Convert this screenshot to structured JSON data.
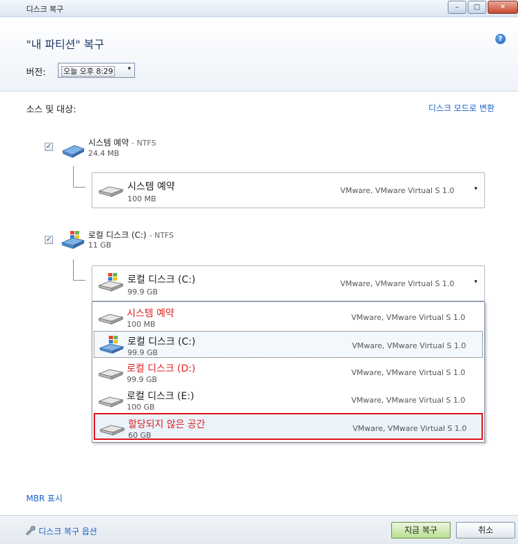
{
  "window": {
    "title": "디스크 복구",
    "minimize": "–",
    "maximize": "□",
    "close": "✕"
  },
  "header": {
    "title": "\"내 파티션\" 복구",
    "help_glyph": "?",
    "version_label": "버전:",
    "version_value": "오늘 오후 8:29",
    "version_arrow": "▾"
  },
  "main": {
    "section_label": "소스 및 대상:",
    "mode_link": "디스크 모드로 변환",
    "sources": [
      {
        "checked": "✓",
        "name": "시스템 예약",
        "fs": "- NTFS",
        "size": "24.4 MB",
        "target": {
          "name": "시스템 예약",
          "size": "100 MB",
          "device": "VMware, VMware Virtual S 1.0",
          "arrow": "▾"
        }
      },
      {
        "checked": "✓",
        "name": "로컬 디스크 (C:)",
        "fs": "- NTFS",
        "size": "11 GB",
        "target": {
          "name": "로컬 디스크 (C:)",
          "size": "99.9 GB",
          "device": "VMware, VMware Virtual S 1.0",
          "arrow": "▾"
        }
      }
    ],
    "dropdown_options": [
      {
        "name": "시스템 예약",
        "size": "100 MB",
        "device": "VMware, VMware Virtual S 1.0"
      },
      {
        "name": "로컬 디스크 (C:)",
        "size": "99.9 GB",
        "device": "VMware, VMware Virtual S 1.0"
      },
      {
        "name": "로컬 디스크 (D:)",
        "size": "99.9 GB",
        "device": "VMware, VMware Virtual S 1.0"
      },
      {
        "name": "로컬 디스크 (E:)",
        "size": "100 GB",
        "device": "VMware, VMware Virtual S 1.0"
      },
      {
        "name": "할당되지 않은 공간",
        "size": "60 GB",
        "device": "VMware, VMware Virtual S 1.0"
      }
    ],
    "mbr_link": "MBR 표시"
  },
  "footer": {
    "options_link": "디스크 복구 옵션",
    "restore_button": "지금 복구",
    "cancel_button": "취소"
  },
  "colors": {
    "link": "#1a63c5",
    "warning_text": "#e02020",
    "highlight_border": "#e20f1a",
    "restore_button": "#b9df92"
  }
}
